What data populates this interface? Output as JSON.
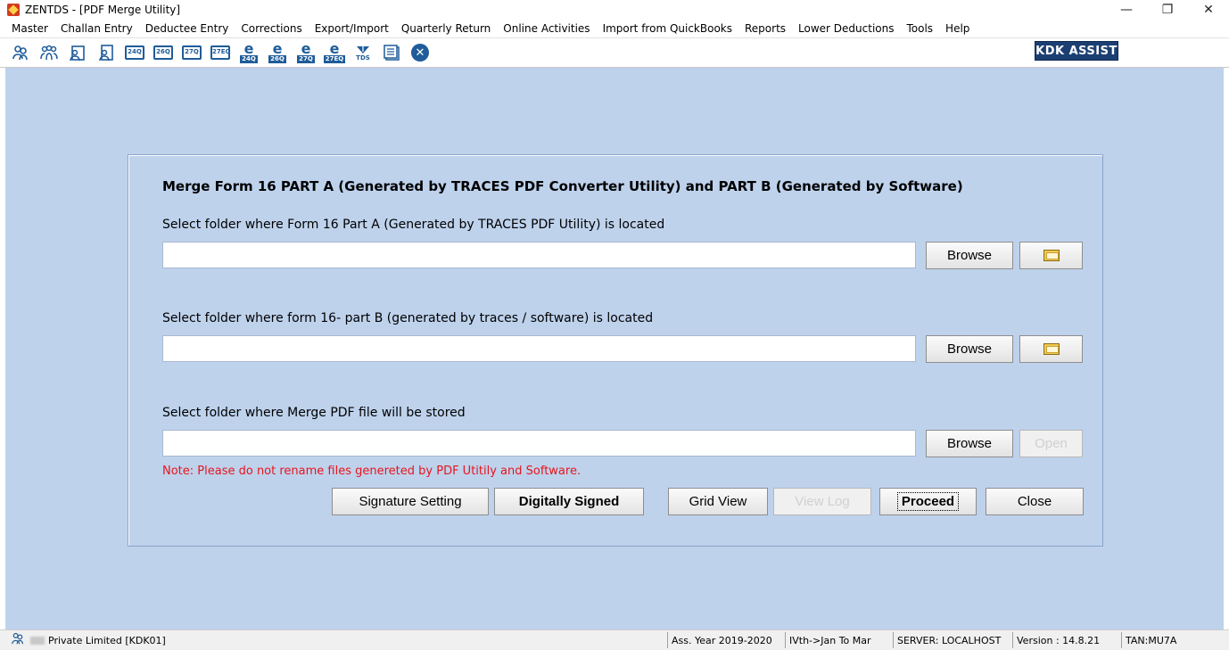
{
  "window": {
    "title": "ZENTDS - [PDF Merge Utility]",
    "minimize": "—",
    "restore": "❐",
    "close": "✕"
  },
  "menu": [
    "Master",
    "Challan Entry",
    "Deductee Entry",
    "Corrections",
    "Export/Import",
    "Quarterly Return",
    "Online Activities",
    "Import from QuickBooks",
    "Reports",
    "Lower Deductions",
    "Tools",
    "Help"
  ],
  "toolbar": {
    "box_labels": [
      "24Q",
      "26Q",
      "27Q",
      "27EQ"
    ],
    "e_labels": [
      "24Q",
      "26Q",
      "27Q",
      "27EQ"
    ],
    "tds_label": "TDS",
    "close_glyph": "✕",
    "assist_label": "KDK ASSIST"
  },
  "panel": {
    "heading": "Merge Form 16 PART A (Generated by TRACES PDF Converter Utility) and PART B (Generated by Software)",
    "part_a_label": "Select folder where Form 16 Part A (Generated by TRACES PDF Utility) is located",
    "part_a_value": "",
    "part_b_label": "Select folder where form 16- part B (generated by traces / software) is located",
    "part_b_value": "",
    "merge_label": "Select folder where Merge PDF file will be stored",
    "merge_value": "",
    "browse_label": "Browse",
    "open_label": "Open",
    "note": "Note: Please do not rename files genereted by PDF Utitily and Software."
  },
  "actions": {
    "signature_setting": "Signature Setting",
    "digitally_signed": "Digitally Signed",
    "grid_view": "Grid View",
    "view_log": "View Log",
    "proceed": "Proceed",
    "close": "Close"
  },
  "status": {
    "company": "Private Limited [KDK01]",
    "ass_year": "Ass. Year 2019-2020",
    "quarter": "IVth->Jan To Mar",
    "server": "SERVER: LOCALHOST",
    "version": "Version : 14.8.21",
    "tan": "TAN:MU7A"
  },
  "colors": {
    "workspace": "#bed2ec",
    "note": "#e8141b",
    "accent": "#1f5c99",
    "assist_bg": "#1b3f73"
  }
}
